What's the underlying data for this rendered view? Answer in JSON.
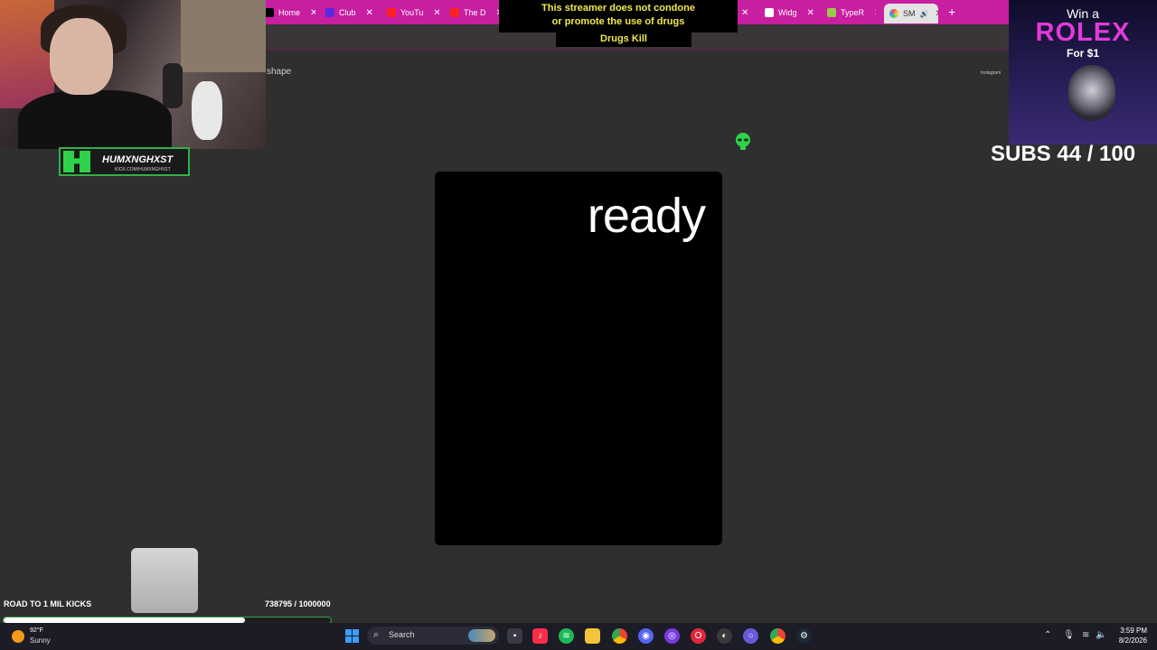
{
  "browser": {
    "tabs": [
      {
        "label": "Home",
        "icon": "x-logo-icon"
      },
      {
        "label": "Club",
        "icon": "club-icon"
      },
      {
        "label": "YouTu",
        "icon": "youtube-icon"
      },
      {
        "label": "The D",
        "icon": "youtube-icon"
      },
      {
        "label": "Widg",
        "icon": "widget-icon"
      },
      {
        "label": "TypeR",
        "icon": "typeracer-icon"
      },
      {
        "label": "SM",
        "icon": "colorful-icon"
      }
    ],
    "new_tab": "+"
  },
  "disclaimer": {
    "line1": "This streamer does not condone",
    "line2": "or promote the use of drugs",
    "line3": "Drugs Kill"
  },
  "streamer": {
    "name": "HUMXNGHXST",
    "url": "KICK.COM/HUMXNGHXST"
  },
  "page": {
    "shape_label": "shape",
    "instagram_label": "Instagram",
    "card_word": "ready"
  },
  "ad": {
    "win": "Win a",
    "brand": "ROLEX",
    "price": "For $1"
  },
  "subs": {
    "text": "SUBS 44 / 100",
    "current": 44,
    "goal": 100
  },
  "kicks_goal": {
    "label": "ROAD TO 1 MIL KICKS",
    "count": "738795 / 1000000",
    "progress": 0.738795
  },
  "taskbar": {
    "temp": "92°F",
    "condition": "Sunny",
    "search_label": "Search",
    "time": "3:59 PM",
    "date": "8/2/2026"
  },
  "colors": {
    "tab_bar": "#c81ea0",
    "desktop": "#2f2f2f",
    "disclaimer_text": "#f2e94b",
    "rolex_brand": "#e23bd8",
    "goal_border": "#3aa04a"
  }
}
